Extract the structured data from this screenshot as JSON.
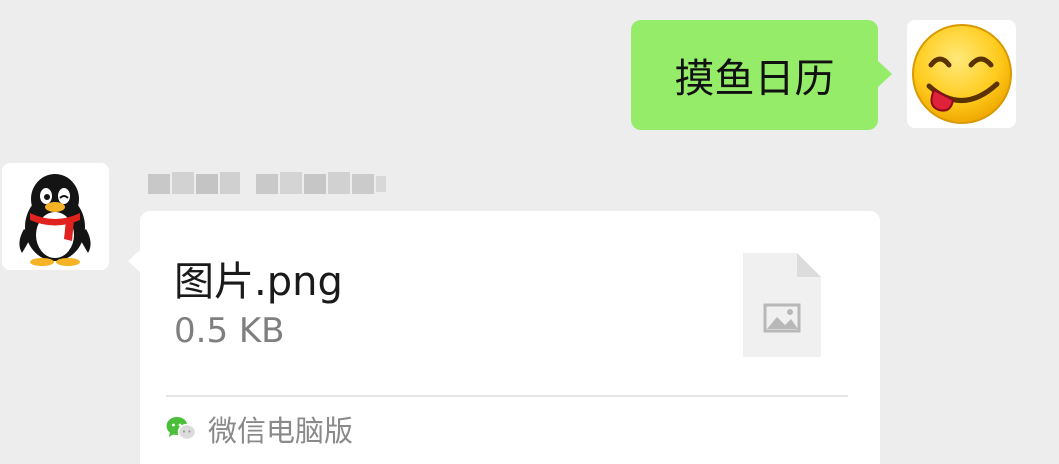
{
  "outgoing": {
    "text": "摸鱼日历",
    "bubble_color": "#95ec69"
  },
  "self": {
    "avatar_icon": "grinning-tongue-emoji-icon"
  },
  "incoming": {
    "avatar_icon": "qq-penguin-icon",
    "sender_name_icon": "blurred-name-icon",
    "file": {
      "name": "图片.png",
      "size": "0.5 KB",
      "type_icon": "image-file-icon"
    },
    "source": {
      "label": "微信电脑版",
      "icon": "wechat-icon",
      "icon_color": "#4cbf3a"
    }
  }
}
